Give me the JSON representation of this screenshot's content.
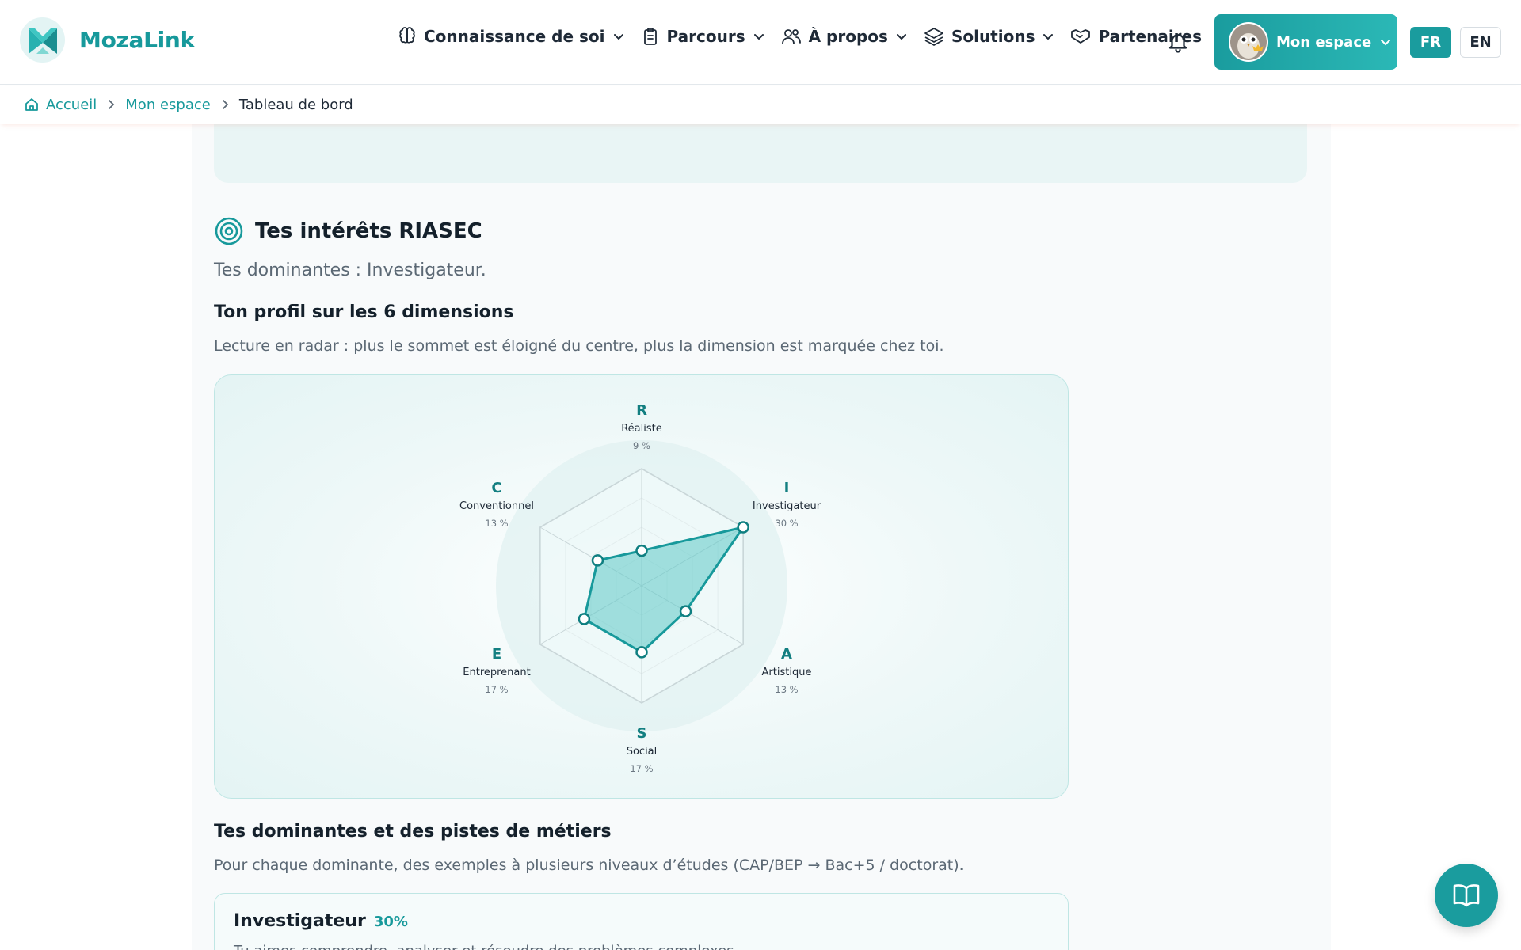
{
  "header": {
    "brand": "MozaLink",
    "nav": [
      {
        "label": "Connaissance de soi",
        "icon": "brain-icon",
        "dropdown": true
      },
      {
        "label": "Parcours",
        "icon": "clipboard-icon",
        "dropdown": true
      },
      {
        "label": "À propos",
        "icon": "users-icon",
        "dropdown": true
      },
      {
        "label": "Solutions",
        "icon": "layers-icon",
        "dropdown": true
      },
      {
        "label": "Partenaires",
        "icon": "handshake-icon",
        "dropdown": false
      }
    ],
    "account_label": "Mon espace",
    "lang_fr": "FR",
    "lang_en": "EN"
  },
  "breadcrumb": {
    "home": "Accueil",
    "parent": "Mon espace",
    "current": "Tableau de bord"
  },
  "riasec": {
    "title": "Tes intérêts RIASEC",
    "dominant_text": "Tes dominantes : Investigateur.",
    "profile_heading": "Ton profil sur les 6 dimensions",
    "profile_desc": "Lecture en radar : plus le sommet est éloigné du centre, plus la dimension est marquée chez toi.",
    "careers_heading": "Tes dominantes et des pistes de métiers",
    "careers_desc": "Pour chaque dominante, des exemples à plusieurs niveaux d’études (CAP/BEP → Bac+5 / doctorat).",
    "card": {
      "name": "Investigateur",
      "pct": "30%",
      "desc": "Tu aimes comprendre, analyser et résoudre des problèmes complexes."
    }
  },
  "chart_data": {
    "type": "radar",
    "max": 30,
    "axes": [
      {
        "letter": "R",
        "name": "Réaliste",
        "value": 9,
        "label": "9 %"
      },
      {
        "letter": "I",
        "name": "Investigateur",
        "value": 30,
        "label": "30 %"
      },
      {
        "letter": "A",
        "name": "Artistique",
        "value": 13,
        "label": "13 %"
      },
      {
        "letter": "S",
        "name": "Social",
        "value": 17,
        "label": "17 %"
      },
      {
        "letter": "E",
        "name": "Entreprenant",
        "value": 17,
        "label": "17 %"
      },
      {
        "letter": "C",
        "name": "Conventionnel",
        "value": 13,
        "label": "13 %"
      }
    ],
    "grid_levels": 4,
    "colors": {
      "accent": "#17999b",
      "fill": "#5cc8c6",
      "grid": "#c9d6d8"
    }
  }
}
